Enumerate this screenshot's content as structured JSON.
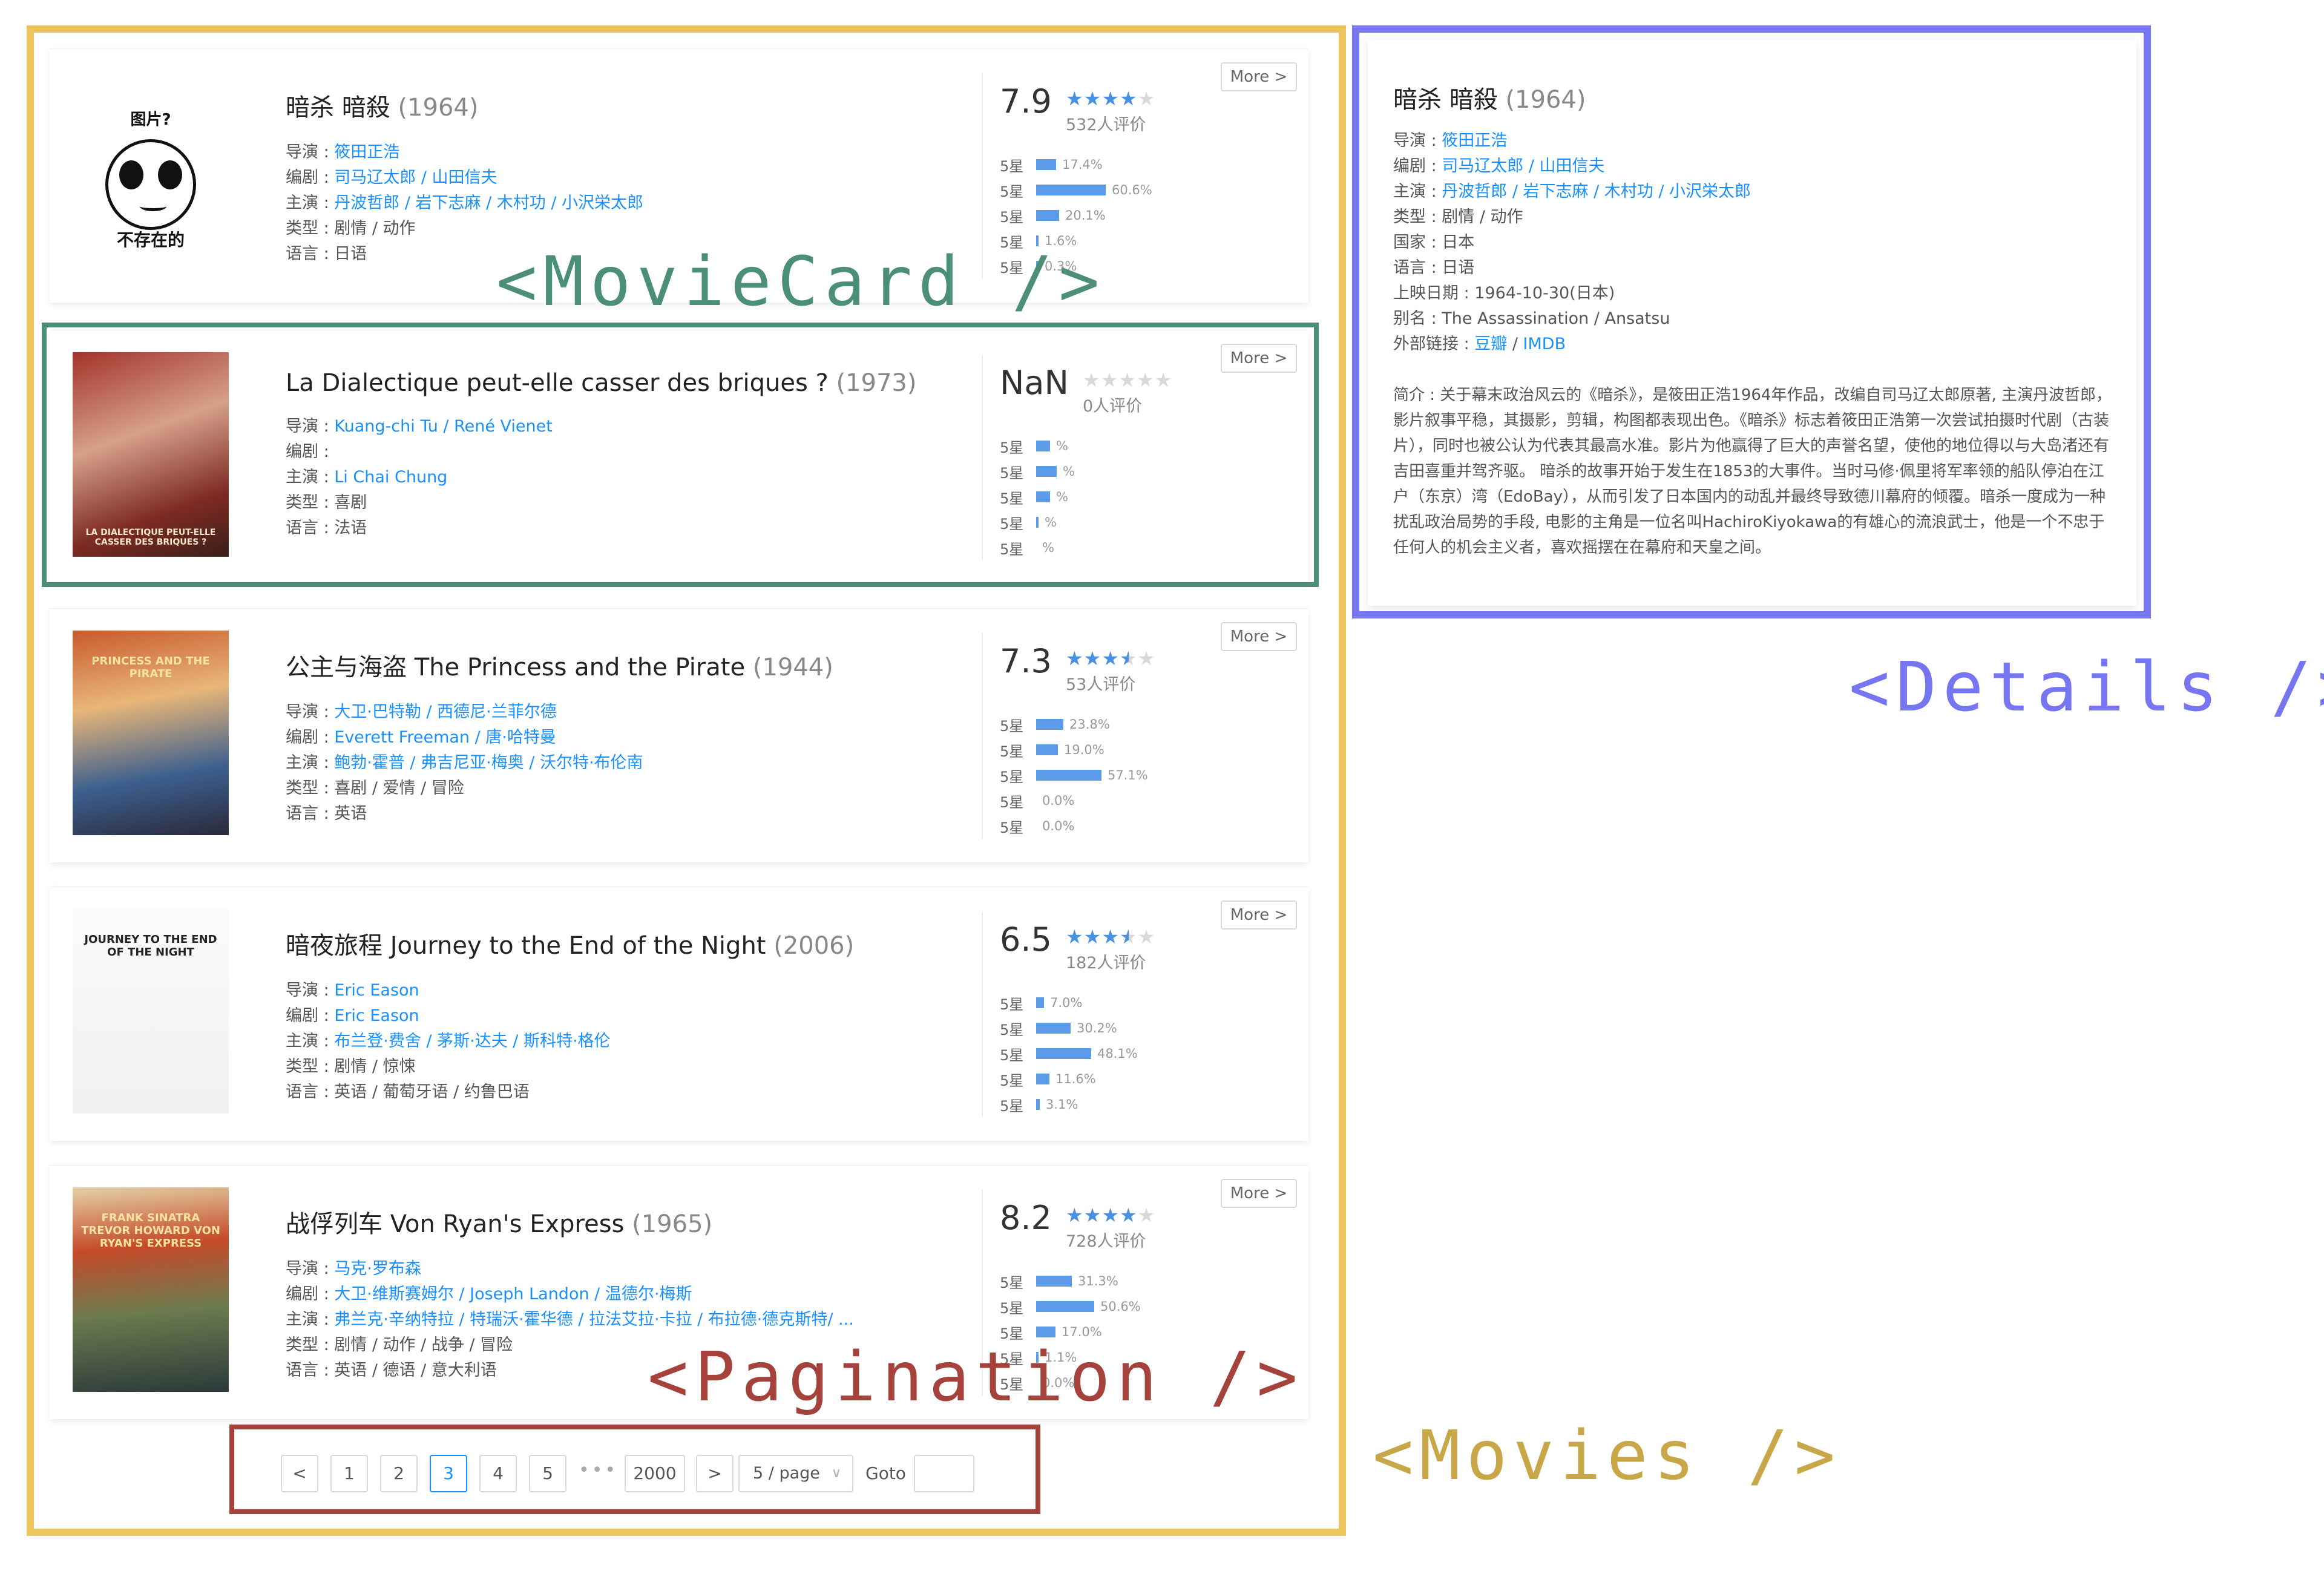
{
  "labels": {
    "movie_card": "<MovieCard />",
    "details": "<Details />",
    "movies": "<Movies />",
    "pagination": "<Pagination />"
  },
  "common": {
    "more": "More >",
    "director": "导演 : ",
    "writer": "编剧 : ",
    "cast": "主演 : ",
    "genre": "类型 : ",
    "language": "语言 : ",
    "star_label": "5星"
  },
  "movies": [
    {
      "title": "暗杀 暗殺",
      "year": "(1964)",
      "poster_caption_top": "图片?",
      "poster_caption_bottom": "不存在的",
      "director": "筱田正浩",
      "writer": "司马辽太郎 / 山田信夫",
      "cast": "丹波哲郎 / 岩下志麻 / 木村功 / 小沢栄太郎",
      "genre": "剧情 / 动作",
      "language": "日语",
      "score": "7.9",
      "stars": 4,
      "count": "532人评价",
      "bars": [
        {
          "pct": "17.4%",
          "value": 17.4
        },
        {
          "pct": "60.6%",
          "value": 60.6
        },
        {
          "pct": "20.1%",
          "value": 20.1
        },
        {
          "pct": "1.6%",
          "value": 1.6
        },
        {
          "pct": "0.3%",
          "value": 0.3
        }
      ]
    },
    {
      "title": "La Dialectique peut-elle casser des briques ?",
      "year": "(1973)",
      "poster_caption_bottom": "LA DIALECTIQUE PEUT-ELLE CASSER DES BRIQUES ?",
      "director": "Kuang-chi Tu / René Vienet",
      "writer": "",
      "cast": "Li Chai Chung",
      "genre": "喜剧",
      "language": "法语",
      "score": "NaN",
      "stars": 0,
      "count": "0人评价",
      "bars": [
        {
          "pct": "%",
          "value": 12
        },
        {
          "pct": "%",
          "value": 18
        },
        {
          "pct": "%",
          "value": 12
        },
        {
          "pct": "%",
          "value": 2
        },
        {
          "pct": "%",
          "value": 0
        }
      ]
    },
    {
      "title": "公主与海盗 The Princess and the Pirate",
      "year": "(1944)",
      "poster_caption_top": "PRINCESS AND THE PIRATE",
      "director": "大卫·巴特勒 / 西德尼·兰菲尔德",
      "writer": "Everett Freeman / 唐·哈特曼",
      "cast": "鲍勃·霍普 / 弗吉尼亚·梅奥 / 沃尔特·布伦南",
      "genre": "喜剧 / 爱情 / 冒险",
      "language": "英语",
      "score": "7.3",
      "stars": 3.5,
      "count": "53人评价",
      "bars": [
        {
          "pct": "23.8%",
          "value": 23.8
        },
        {
          "pct": "19.0%",
          "value": 19.0
        },
        {
          "pct": "57.1%",
          "value": 57.1
        },
        {
          "pct": "0.0%",
          "value": 0
        },
        {
          "pct": "0.0%",
          "value": 0
        }
      ]
    },
    {
      "title": "暗夜旅程 Journey to the End of the Night",
      "year": "(2006)",
      "poster_caption_top": "JOURNEY TO THE END OF THE NIGHT",
      "director": "Eric Eason",
      "writer": "Eric Eason",
      "cast": "布兰登·费舍 / 茅斯·达夫 / 斯科特·格伦",
      "genre": "剧情 / 惊悚",
      "language": "英语 / 葡萄牙语 / 约鲁巴语",
      "score": "6.5",
      "stars": 3.5,
      "count": "182人评价",
      "bars": [
        {
          "pct": "7.0%",
          "value": 7.0
        },
        {
          "pct": "30.2%",
          "value": 30.2
        },
        {
          "pct": "48.1%",
          "value": 48.1
        },
        {
          "pct": "11.6%",
          "value": 11.6
        },
        {
          "pct": "3.1%",
          "value": 3.1
        }
      ]
    },
    {
      "title": "战俘列车 Von Ryan's Express",
      "year": "(1965)",
      "poster_caption_top": "FRANK SINATRA TREVOR HOWARD VON RYAN'S EXPRESS",
      "director": "马克·罗布森",
      "writer": "大卫·维斯赛姆尔 / Joseph Landon / 温德尔·梅斯",
      "cast": "弗兰克·辛纳特拉 / 特瑞沃·霍华德 / 拉法艾拉·卡拉 / 布拉德·德克斯特/ ...",
      "genre": "剧情 / 动作 / 战争 / 冒险",
      "language": "英语 / 德语 / 意大利语",
      "score": "8.2",
      "stars": 4,
      "count": "728人评价",
      "bars": [
        {
          "pct": "31.3%",
          "value": 31.3
        },
        {
          "pct": "50.6%",
          "value": 50.6
        },
        {
          "pct": "17.0%",
          "value": 17.0
        },
        {
          "pct": "1.1%",
          "value": 1.1
        },
        {
          "pct": "0.0%",
          "value": 0
        }
      ]
    }
  ],
  "pagination": {
    "prev": "<",
    "next": ">",
    "pages": [
      "1",
      "2",
      "3",
      "4",
      "5"
    ],
    "ellipsis": "•••",
    "last": "2000",
    "current": "3",
    "page_size": "5 / page",
    "goto": "Goto"
  },
  "details": {
    "title": "暗杀 暗殺",
    "year": "(1964)",
    "director_label": "导演 : ",
    "director": "筱田正浩",
    "writer_label": "编剧 : ",
    "writer": "司马辽太郎 / 山田信夫",
    "cast_label": "主演 : ",
    "cast": "丹波哲郎 / 岩下志麻 / 木村功 / 小沢栄太郎",
    "genre": "类型 : 剧情 / 动作",
    "country": "国家 : 日本",
    "language": "语言 : 日语",
    "release": "上映日期 : 1964-10-30(日本)",
    "aka": "别名 : The Assassination / Ansatsu",
    "links_label": "外部链接 : ",
    "link_douban": "豆瓣",
    "link_sep": " / ",
    "link_imdb": "IMDB",
    "summary": "简介 : 关于幕末政治风云的《暗杀》，是筱田正浩1964年作品，改编自司马辽太郎原著, 主演丹波哲郎，影片叙事平稳，其摄影，剪辑，构图都表现出色。《暗杀》标志着筱田正浩第一次尝试拍摄时代剧（古装片），同时也被公认为代表其最高水准。影片为他赢得了巨大的声誉名望，使他的地位得以与大岛渚还有吉田喜重并驾齐驱。 暗杀的故事开始于发生在1853的大事件。当时马修·佩里将军率领的船队停泊在江户（东京）湾（EdoBay），从而引发了日本国内的动乱并最终导致德川幕府的倾覆。暗杀一度成为一种扰乱政治局势的手段, 电影的主角是一位名叫HachiroKiyokawa的有雄心的流浪武士，他是一个不忠于任何人的机会主义者，喜欢摇摆在在幕府和天皇之间。"
  }
}
